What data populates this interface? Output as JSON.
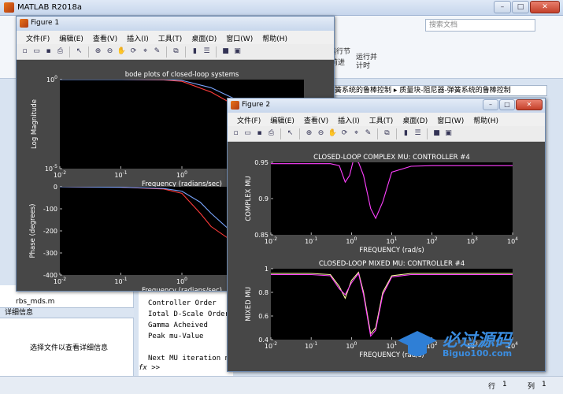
{
  "app": {
    "title": "MATLAB R2018a"
  },
  "search": {
    "placeholder": "搜索文档"
  },
  "ribbon": {
    "run_section": "运行节",
    "advance": "前进",
    "run_and_time": "运行并计时"
  },
  "path": {
    "text": "簧系统的鲁棒控制 ▸ 质量块-阻尼器-弹簧系统的鲁棒控制"
  },
  "files": {
    "item1": "rbs_mds.m"
  },
  "details": {
    "header": "详细信息",
    "hint": "选择文件以查看详细信息"
  },
  "command": {
    "lines": [
      "Controller Order",
      "Iotal D-Scale Order",
      "Gamma Acheived",
      "Peak mu-Value",
      "Next MU iteration n"
    ],
    "prompt": "fx >>"
  },
  "status": {
    "row": "行",
    "row_val": "1",
    "col": "列",
    "col_val": "1"
  },
  "menu": [
    "文件(F)",
    "编辑(E)",
    "查看(V)",
    "插入(I)",
    "工具(T)",
    "桌面(D)",
    "窗口(W)",
    "帮助(H)"
  ],
  "figure1": {
    "title": "Figure 1",
    "chart_data": [
      {
        "type": "line",
        "title": "bode plots of closed-loop systems",
        "xlabel": "Frequency (radians/sec)",
        "ylabel": "Log Magnitude",
        "xscale": "log",
        "yscale": "log",
        "xlim": [
          0.01,
          100
        ],
        "ylim": [
          1e-05,
          1
        ],
        "xticks": [
          "10^{-2}",
          "10^{-1}",
          "10^{0}"
        ],
        "yticks": [
          "10^{0}",
          "10^{-5}"
        ],
        "series": [
          {
            "color": "#ff3b3b",
            "x": [
              0.01,
              0.1,
              0.5,
              1,
              3,
              10,
              30,
              100
            ],
            "y": [
              1,
              1,
              0.95,
              0.8,
              0.2,
              0.02,
              0.002,
              0.0002
            ]
          },
          {
            "color": "#7aa6ff",
            "x": [
              0.01,
              0.1,
              0.5,
              1,
              3,
              10,
              30,
              100
            ],
            "y": [
              1,
              1,
              1,
              0.9,
              0.35,
              0.05,
              0.005,
              0.0005
            ]
          }
        ]
      },
      {
        "type": "line",
        "xlabel": "Frequency (radians/sec)",
        "ylabel": "Phase (degrees)",
        "xscale": "log",
        "xlim": [
          0.01,
          100
        ],
        "ylim": [
          -400,
          0
        ],
        "xticks": [
          "10^{-2}",
          "10^{-1}",
          "10^{0}"
        ],
        "yticks": [
          "0",
          "-100",
          "-200",
          "-300",
          "-400"
        ],
        "series": [
          {
            "color": "#ff3b3b",
            "x": [
              0.01,
              0.1,
              0.5,
              1,
              2,
              3,
              10,
              100
            ],
            "y": [
              0,
              -2,
              -10,
              -30,
              -120,
              -180,
              -280,
              -360
            ]
          },
          {
            "color": "#7aa6ff",
            "x": [
              0.01,
              0.1,
              0.5,
              1,
              2,
              3,
              10,
              100
            ],
            "y": [
              0,
              -2,
              -8,
              -20,
              -70,
              -120,
              -250,
              -350
            ]
          }
        ]
      }
    ]
  },
  "figure2": {
    "title": "Figure 2",
    "chart_data": [
      {
        "type": "line",
        "title": "CLOSED-LOOP COMPLEX MU: CONTROLLER #4",
        "xlabel": "FREQUENCY   (rad/s)",
        "ylabel": "COMPLEX MU",
        "xscale": "log",
        "xlim": [
          0.01,
          10000
        ],
        "ylim": [
          0.85,
          0.96
        ],
        "xticks": [
          "10^{-2}",
          "10^{-1}",
          "10^{0}",
          "10^{1}",
          "10^{2}",
          "10^{3}",
          "10^{4}"
        ],
        "yticks": [
          "0.95",
          "0.9",
          "0.85"
        ],
        "series": [
          {
            "color": "#ff40ff",
            "x": [
              0.01,
              0.1,
              0.3,
              0.5,
              0.7,
              0.9,
              1.1,
              1.5,
              2,
              3,
              4,
              6,
              10,
              30,
              100,
              1000,
              10000
            ],
            "y": [
              0.958,
              0.958,
              0.958,
              0.955,
              0.93,
              0.94,
              0.962,
              0.96,
              0.94,
              0.89,
              0.875,
              0.9,
              0.945,
              0.954,
              0.955,
              0.955,
              0.955
            ]
          }
        ]
      },
      {
        "type": "line",
        "title": "CLOSED-LOOP MIXED MU: CONTROLLER #4",
        "xlabel": "FREQUENCY   (rad/s)",
        "ylabel": "MIXED MU",
        "xscale": "log",
        "xlim": [
          0.01,
          10000
        ],
        "ylim": [
          0.4,
          1
        ],
        "xticks": [
          "10^{-2}",
          "10^{-1}",
          "10^{0}",
          "10^{1}",
          "10^{2}",
          "10^{3}",
          "10^{4}"
        ],
        "yticks": [
          "1",
          "0.8",
          "0.6",
          "0.4"
        ],
        "series": [
          {
            "color": "#ffffa0",
            "x": [
              0.01,
              0.1,
              0.3,
              0.5,
              0.7,
              1,
              1.5,
              2,
              3,
              4,
              6,
              10,
              30,
              100,
              1000,
              10000
            ],
            "y": [
              0.96,
              0.96,
              0.95,
              0.85,
              0.75,
              0.9,
              0.97,
              0.8,
              0.45,
              0.5,
              0.8,
              0.94,
              0.96,
              0.96,
              0.96,
              0.96
            ]
          },
          {
            "color": "#ff40ff",
            "x": [
              0.01,
              0.1,
              0.3,
              0.5,
              0.7,
              1,
              1.5,
              2,
              3,
              4,
              6,
              10,
              30,
              100,
              1000,
              10000
            ],
            "y": [
              0.95,
              0.95,
              0.94,
              0.83,
              0.78,
              0.88,
              0.96,
              0.78,
              0.43,
              0.48,
              0.78,
              0.93,
              0.95,
              0.95,
              0.95,
              0.95
            ]
          }
        ]
      }
    ]
  },
  "watermark": {
    "text": "必过源码",
    "url": "Biguo100.com"
  }
}
